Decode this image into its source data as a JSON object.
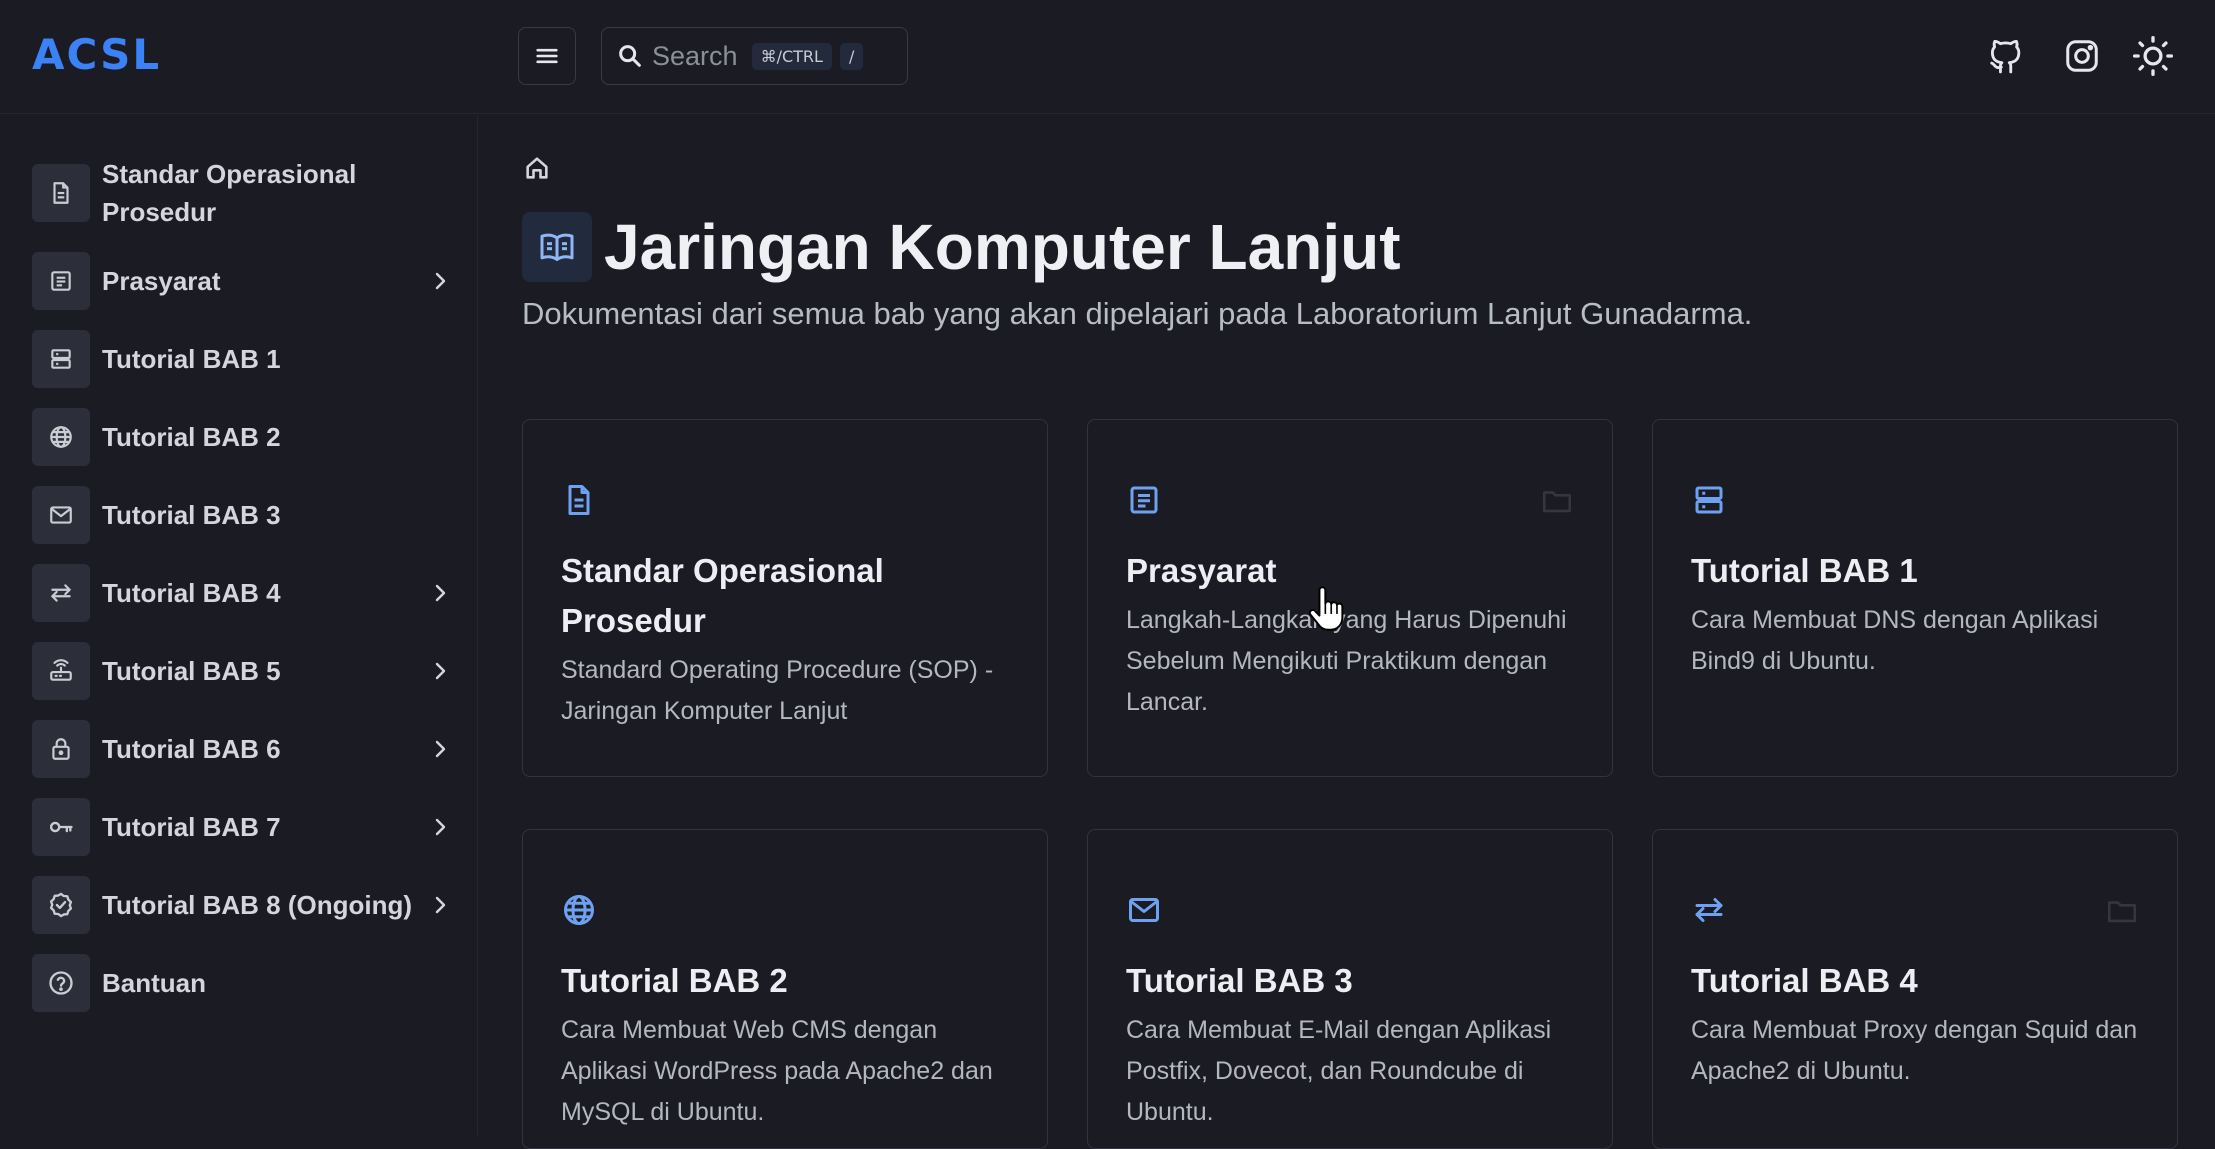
{
  "brand": {
    "logo": "ACSL",
    "accent": "#3b82f6"
  },
  "search": {
    "placeholder": "Search",
    "shortcut_1": "⌘/CTRL",
    "shortcut_2": "/"
  },
  "header_icons": [
    "github-icon",
    "instagram-icon",
    "theme-toggle-icon"
  ],
  "sidebar": {
    "items": [
      {
        "label": "Standar Operasional Prosedur",
        "icon": "document-icon",
        "has_children": false
      },
      {
        "label": "Prasyarat",
        "icon": "list-icon",
        "has_children": true
      },
      {
        "label": "Tutorial BAB 1",
        "icon": "server-icon",
        "has_children": false
      },
      {
        "label": "Tutorial BAB 2",
        "icon": "globe-icon",
        "has_children": false
      },
      {
        "label": "Tutorial BAB 3",
        "icon": "mail-icon",
        "has_children": false
      },
      {
        "label": "Tutorial BAB 4",
        "icon": "arrows-icon",
        "has_children": true
      },
      {
        "label": "Tutorial BAB 5",
        "icon": "router-icon",
        "has_children": true
      },
      {
        "label": "Tutorial BAB 6",
        "icon": "lock-icon",
        "has_children": true
      },
      {
        "label": "Tutorial BAB 7",
        "icon": "key-icon",
        "has_children": true
      },
      {
        "label": "Tutorial BAB 8 (Ongoing)",
        "icon": "badge-check-icon",
        "has_children": true
      },
      {
        "label": "Bantuan",
        "icon": "help-icon",
        "has_children": false
      }
    ]
  },
  "main": {
    "title": "Jaringan Komputer Lanjut",
    "subtitle": "Dokumentasi dari semua bab yang akan dipelajari pada Laboratorium Lanjut Gunadarma.",
    "cards": [
      {
        "title": "Standar Operasional Prosedur",
        "description": "Standard Operating Procedure (SOP) - Jaringan Komputer Lanjut",
        "icon": "document-icon"
      },
      {
        "title": "Prasyarat",
        "description": "Langkah-Langkah yang Harus Dipenuhi Sebelum Mengikuti Praktikum dengan Lancar.",
        "icon": "list-icon"
      },
      {
        "title": "Tutorial BAB 1",
        "description": "Cara Membuat DNS dengan Aplikasi Bind9 di Ubuntu.",
        "icon": "server-icon"
      },
      {
        "title": "Tutorial BAB 2",
        "description": "Cara Membuat Web CMS dengan Aplikasi WordPress pada Apache2 dan MySQL di Ubuntu.",
        "icon": "globe-icon"
      },
      {
        "title": "Tutorial BAB 3",
        "description": "Cara Membuat E-Mail dengan Aplikasi Postfix, Dovecot, dan Roundcube di Ubuntu.",
        "icon": "mail-icon"
      },
      {
        "title": "Tutorial BAB 4",
        "description": "Cara Membuat Proxy dengan Squid dan Apache2 di Ubuntu.",
        "icon": "arrows-icon"
      }
    ]
  }
}
